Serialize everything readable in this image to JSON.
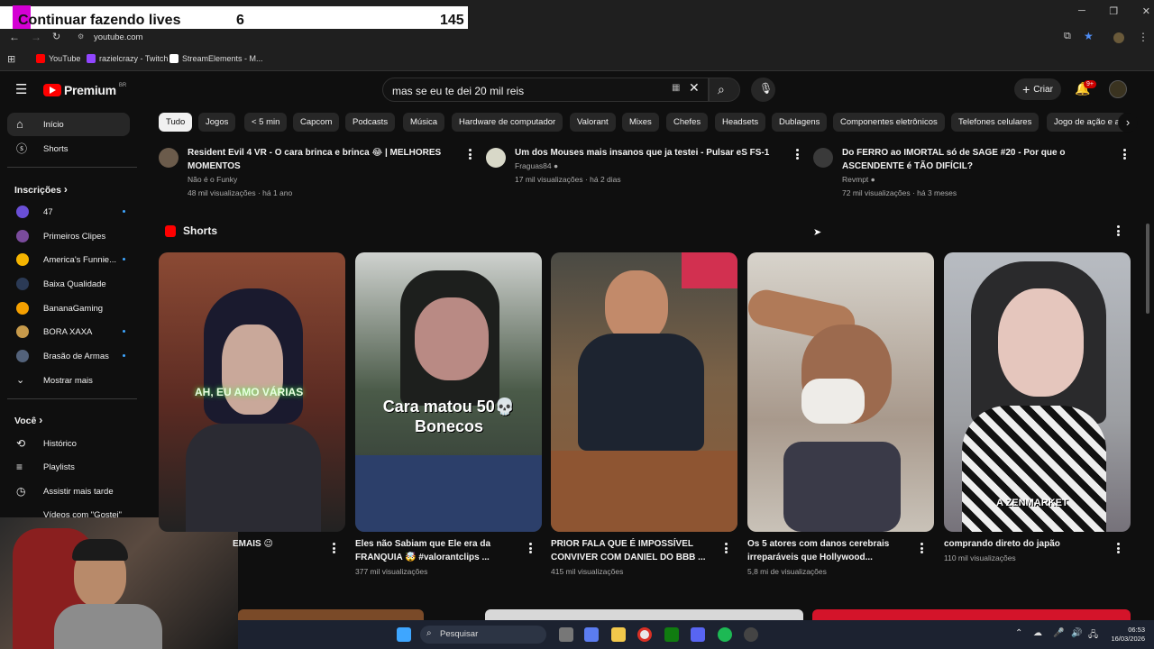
{
  "overlay": {
    "title": "Continuar fazendo lives",
    "count_a": "6",
    "count_b": "145"
  },
  "browser": {
    "url": "youtube.com"
  },
  "bookmarks": [
    {
      "label": "YouTube",
      "icon": "youtube-icon",
      "color": "#ff0000"
    },
    {
      "label": "razielcrazy - Twitch",
      "icon": "twitch-icon",
      "color": "#9146ff"
    },
    {
      "label": "StreamElements - M...",
      "icon": "streamelements-icon",
      "color": "#ffffff"
    }
  ],
  "header": {
    "logo": "Premium",
    "region": "BR",
    "search_value": "mas se eu te dei 20 mil reis",
    "create_label": "Criar",
    "notif_badge": "9+"
  },
  "chips": [
    "Tudo",
    "Jogos",
    "< 5 min",
    "Capcom",
    "Podcasts",
    "Música",
    "Hardware de computador",
    "Valorant",
    "Mixes",
    "Chefes",
    "Headsets",
    "Dublagens",
    "Componentes eletrônicos",
    "Telefones celulares",
    "Jogo de ação e a"
  ],
  "sidebar": {
    "home": "Início",
    "shorts": "Shorts",
    "subs_title": "Inscrições",
    "subs": [
      {
        "label": "47",
        "dot": true,
        "color": "#6a4fd6"
      },
      {
        "label": "Primeiros Clipes",
        "dot": false,
        "color": "#7a4b9c"
      },
      {
        "label": "America's Funnie...",
        "dot": true,
        "color": "#f5b400"
      },
      {
        "label": "Baixa Qualidade",
        "dot": false,
        "color": "#2b3a55"
      },
      {
        "label": "BananaGaming",
        "dot": false,
        "color": "#f5a000"
      },
      {
        "label": "BORA XAXA",
        "dot": true,
        "color": "#c79a4b"
      },
      {
        "label": "Brasão de Armas",
        "dot": true,
        "color": "#53627a"
      }
    ],
    "more": "Mostrar mais",
    "you_title": "Você",
    "you": [
      "Histórico",
      "Playlists",
      "Assistir mais tarde",
      "Vídeos com \"Gostei\""
    ]
  },
  "top_videos": [
    {
      "title1": "Resident Evil 4 VR - O cara brinca e brinca 😂 | MELHORES",
      "title2": "MOMENTOS",
      "channel": "Não é o Funky",
      "verified": false,
      "stats": "48 mil visualizações · há 1 ano"
    },
    {
      "title1": "Um dos Mouses mais insanos que ja testei - Pulsar eS FS-1",
      "title2": "",
      "channel": "Fraguas84",
      "verified": true,
      "stats": "17 mil visualizações · há 2 dias"
    },
    {
      "title1": "Do FERRO ao IMORTAL só de SAGE #20 - Por que o",
      "title2": "ASCENDENTE é TÃO DIFÍCIL?",
      "channel": "Revmpt",
      "verified": true,
      "stats": "72 mil visualizações · há 3 meses"
    }
  ],
  "shorts_section": {
    "title": "Shorts"
  },
  "shorts": [
    {
      "title1": "EMAIS 😉",
      "title2": "",
      "views": "",
      "overlay": "AH, EU AMO VÁRIAS",
      "bg": "#7a3f2e"
    },
    {
      "title1": "Eles não Sabiam que Ele era da",
      "title2": "FRANQUIA 🤯 #valorantclips ...",
      "views": "377 mil visualizações",
      "overlay": "Cara matou 50💀 Bonecos",
      "bg": "#3b4a3e"
    },
    {
      "title1": "PRIOR FALA QUE É IMPOSSÍVEL",
      "title2": "CONVIVER COM DANIEL DO BBB ...",
      "views": "415 mil visualizações",
      "overlay": "",
      "bg": "#6d5a43"
    },
    {
      "title1": "Os 5 atores com danos cerebrais",
      "title2": "irreparáveis que Hollywood...",
      "views": "5,8 mi de visualizações",
      "overlay": "",
      "bg": "#8a7f73"
    },
    {
      "title1": "comprando direto do japão",
      "title2": "",
      "views": "110 mil visualizações",
      "overlay": "A ZENMARKET",
      "bg": "#9a9ca0"
    }
  ],
  "taskbar": {
    "search_label": "Pesquisar",
    "time": "06:53",
    "date": "16/03/2026"
  }
}
